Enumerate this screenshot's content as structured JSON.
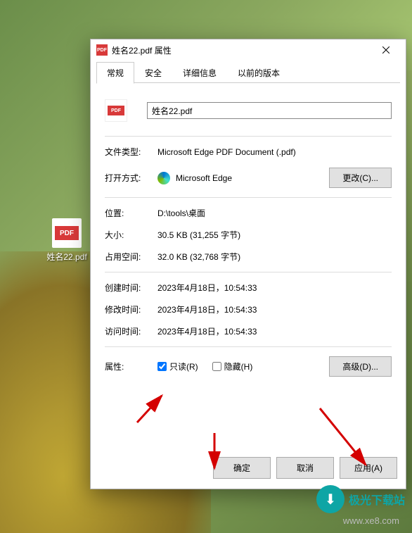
{
  "desktop": {
    "icon_label": "姓名22.pdf",
    "icon_badge": "PDF"
  },
  "watermark": {
    "text": "极光下载站",
    "url": "www.xe8.com"
  },
  "dialog": {
    "title": "姓名22.pdf 属性",
    "title_badge": "PDF",
    "tabs": {
      "general": "常规",
      "security": "安全",
      "details": "详细信息",
      "previous": "以前的版本"
    },
    "filename": "姓名22.pdf",
    "rows": {
      "file_type_label": "文件类型:",
      "file_type_value": "Microsoft Edge PDF Document (.pdf)",
      "open_with_label": "打开方式:",
      "open_with_value": "Microsoft Edge",
      "change_btn": "更改(C)...",
      "location_label": "位置:",
      "location_value": "D:\\tools\\桌面",
      "size_label": "大小:",
      "size_value": "30.5 KB (31,255 字节)",
      "size_on_disk_label": "占用空间:",
      "size_on_disk_value": "32.0 KB (32,768 字节)",
      "created_label": "创建时间:",
      "created_value": "2023年4月18日，10:54:33",
      "modified_label": "修改时间:",
      "modified_value": "2023年4月18日，10:54:33",
      "accessed_label": "访问时间:",
      "accessed_value": "2023年4月18日，10:54:33",
      "attrs_label": "属性:",
      "readonly_label": "只读(R)",
      "readonly_checked": true,
      "hidden_label": "隐藏(H)",
      "hidden_checked": false,
      "advanced_btn": "高级(D)..."
    },
    "buttons": {
      "ok": "确定",
      "cancel": "取消",
      "apply": "应用(A)"
    }
  }
}
